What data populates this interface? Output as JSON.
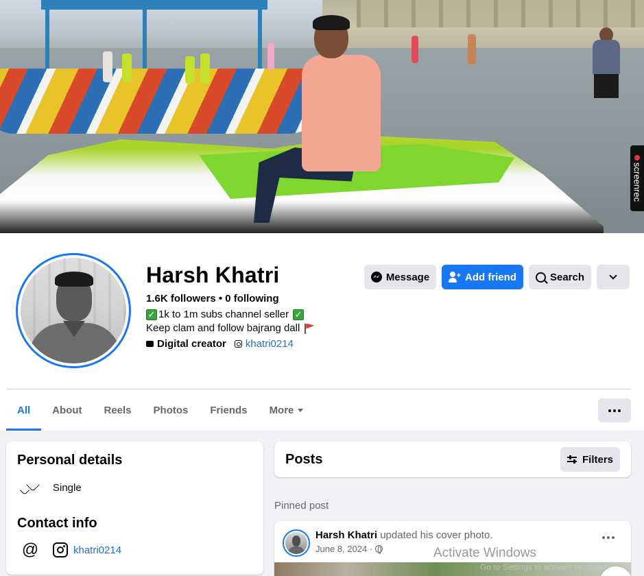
{
  "profile": {
    "name": "Harsh Khatri",
    "followers_line": "1.6K followers • 0 following",
    "bio_line1": "1k to 1m subs channel seller",
    "bio_line2": "Keep clam and follow bajrang dall",
    "category": "Digital creator",
    "instagram_handle": "khatri0214"
  },
  "actions": {
    "message_label": "Message",
    "add_friend_label": "Add friend",
    "search_label": "Search"
  },
  "tabs": [
    {
      "label": "All",
      "active": true
    },
    {
      "label": "About"
    },
    {
      "label": "Reels"
    },
    {
      "label": "Photos"
    },
    {
      "label": "Friends"
    },
    {
      "label": "More"
    }
  ],
  "personal_details": {
    "title": "Personal details",
    "relationship": "Single"
  },
  "contact_info": {
    "title": "Contact info",
    "instagram": "khatri0214"
  },
  "posts": {
    "title": "Posts",
    "filters_label": "Filters",
    "pinned_label": "Pinned post",
    "pinned": {
      "author": "Harsh Khatri",
      "action": "updated his cover photo.",
      "date": "June 8, 2024 ·"
    }
  },
  "overlay": {
    "screenrec_label": "screenrec",
    "watermark": "Activate Windows",
    "watermark_sub": "Go to Settings to activate Windows."
  },
  "colors": {
    "accent": "#1877f2",
    "link": "#216fdb",
    "page_bg": "#f0f2f5",
    "button_grey": "#e4e6eb"
  },
  "icons": {
    "message": "messenger-icon",
    "add_friend": "add-user-icon",
    "search": "search-icon",
    "more": "chevron-down-icon",
    "relationship": "hearts-icon",
    "email": "at-icon",
    "instagram": "instagram-icon",
    "privacy": "globe-icon"
  }
}
